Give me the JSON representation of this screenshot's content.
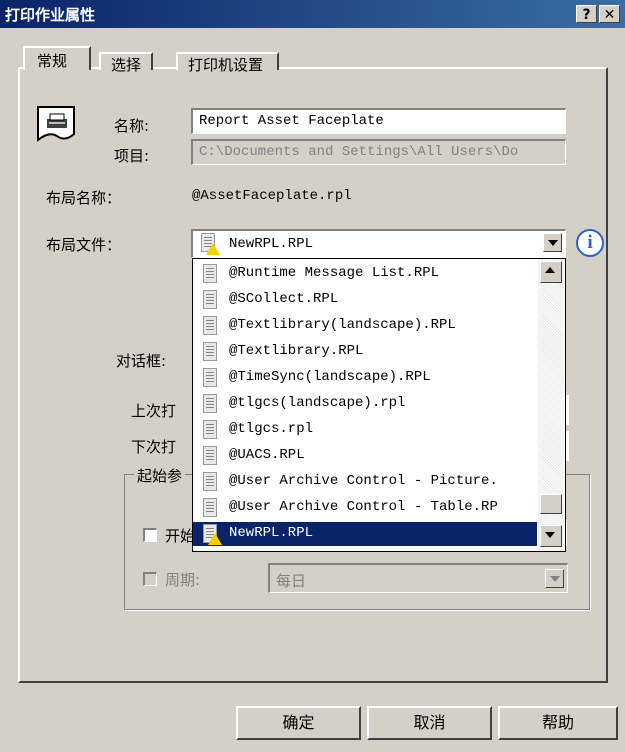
{
  "window": {
    "title": "打印作业属性",
    "help_glyph": "?",
    "close_glyph": "✕"
  },
  "tabs": [
    {
      "label": "常规"
    },
    {
      "label": "选择"
    },
    {
      "label": "打印机设置"
    }
  ],
  "general": {
    "name_label": "名称:",
    "name_value": "Report Asset Faceplate",
    "project_label": "项目:",
    "project_value": "C:\\Documents and Settings\\All Users\\Do",
    "layout_name_label": "布局名称：",
    "layout_name_value": "@AssetFaceplate.rpl",
    "layout_file_label": "布局文件：",
    "layout_file_selected": "NewRPL.RPL",
    "info_glyph": "i",
    "dialog_label": "对话框:",
    "last_label": "上次打",
    "next_label": "下次打",
    "start_group_label": "起始参",
    "start_checkbox_label": "开始",
    "period_label": "周期:",
    "period_value": "每日"
  },
  "dropdown": {
    "items": [
      "@Runtime Message List.RPL",
      "@SCollect.RPL",
      "@Textlibrary(landscape).RPL",
      "@Textlibrary.RPL",
      "@TimeSync(landscape).RPL",
      "@tlgcs(landscape).rpl",
      "@tlgcs.rpl",
      "@UACS.RPL",
      "@User Archive Control - Picture.",
      "@User Archive Control - Table.RP",
      "NewRPL.RPL"
    ],
    "selected_index": 10
  },
  "buttons": {
    "ok": "确定",
    "cancel": "取消",
    "help": "帮助"
  },
  "colors": {
    "titlebar": "#0a246a",
    "selection": "#0a246a",
    "face": "#d4d0c8",
    "warning": "#f5d000"
  }
}
